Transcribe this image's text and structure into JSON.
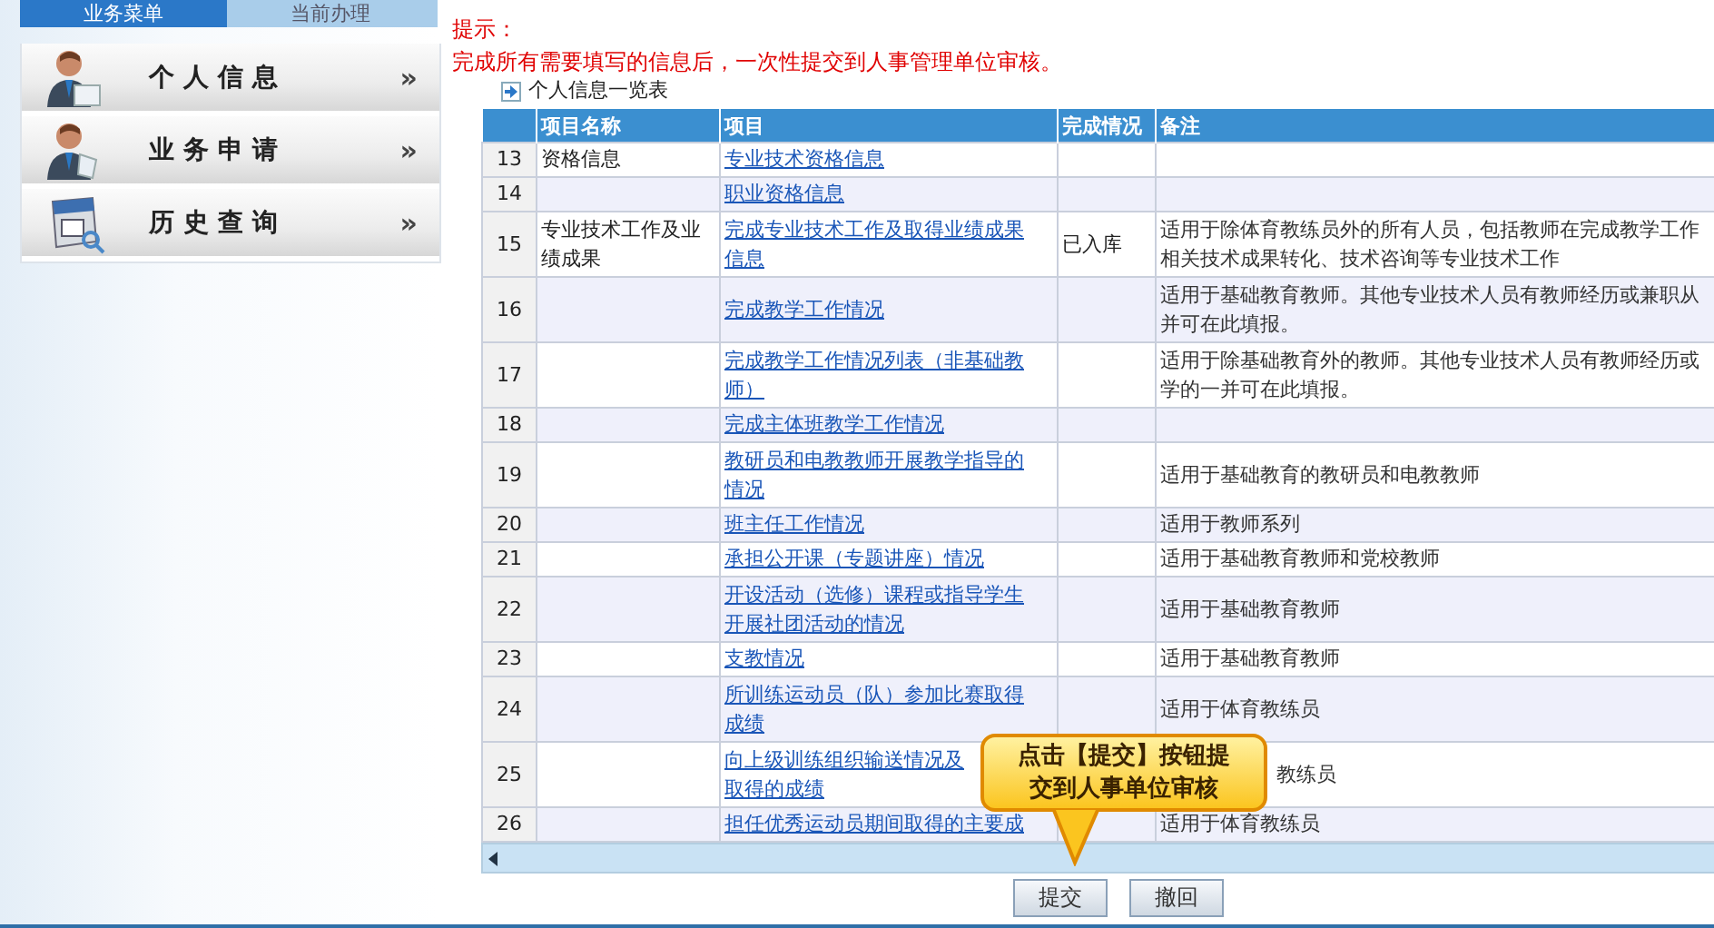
{
  "sidebar": {
    "tabs": [
      {
        "label": "业务菜单",
        "selected": true
      },
      {
        "label": "当前办理",
        "selected": false
      }
    ],
    "items": [
      {
        "kind": "person-card",
        "label": "个人信息",
        "chevron": "»"
      },
      {
        "kind": "person-doc",
        "label": "业务申请",
        "chevron": "»"
      },
      {
        "kind": "calendar",
        "label": "历史查询",
        "chevron": "»"
      }
    ]
  },
  "hint": {
    "title": "提示：",
    "text": "完成所有需要填写的信息后，一次性提交到人事管理单位审核。"
  },
  "table": {
    "caption": "个人信息一览表",
    "columns": [
      "项目名称",
      "项目",
      "完成情况",
      "备注"
    ],
    "rows": [
      {
        "no": "13",
        "name": [
          "资格信息"
        ],
        "item": [
          "专业技术资格信息"
        ],
        "status": "",
        "remark": []
      },
      {
        "no": "14",
        "name": [],
        "item": [
          "职业资格信息"
        ],
        "status": "",
        "remark": []
      },
      {
        "no": "15",
        "name": [
          "专业技术工作及业",
          "绩成果"
        ],
        "item": [
          "完成专业技术工作及取得业绩成果",
          "信息"
        ],
        "status": "已入库",
        "remark": [
          "适用于除体育教练员外的所有人员，包括教师在完成教学工作",
          "相关技术成果转化、技术咨询等专业技术工作"
        ]
      },
      {
        "no": "16",
        "name": [],
        "item": [
          "完成教学工作情况"
        ],
        "status": "",
        "remark": [
          "适用于基础教育教师。其他专业技术人员有教师经历或兼职从",
          "并可在此填报。"
        ]
      },
      {
        "no": "17",
        "name": [],
        "item": [
          "完成教学工作情况列表（非基础教",
          "师）"
        ],
        "status": "",
        "remark": [
          "适用于除基础教育外的教师。其他专业技术人员有教师经历或",
          "学的一并可在此填报。"
        ]
      },
      {
        "no": "18",
        "name": [],
        "item": [
          "完成主体班教学工作情况"
        ],
        "status": "",
        "remark": []
      },
      {
        "no": "19",
        "name": [],
        "item": [
          "教研员和电教教师开展教学指导的",
          "情况"
        ],
        "status": "",
        "remark": [
          "适用于基础教育的教研员和电教教师"
        ]
      },
      {
        "no": "20",
        "name": [],
        "item": [
          "班主任工作情况"
        ],
        "status": "",
        "remark": [
          "适用于教师系列"
        ]
      },
      {
        "no": "21",
        "name": [],
        "item": [
          "承担公开课（专题讲座）情况"
        ],
        "status": "",
        "remark": [
          "适用于基础教育教师和党校教师"
        ]
      },
      {
        "no": "22",
        "name": [],
        "item": [
          "开设活动（选修）课程或指导学生",
          "开展社团活动的情况"
        ],
        "status": "",
        "remark": [
          "适用于基础教育教师"
        ]
      },
      {
        "no": "23",
        "name": [],
        "item": [
          "支教情况"
        ],
        "status": "",
        "remark": [
          "适用于基础教育教师"
        ]
      },
      {
        "no": "24",
        "name": [],
        "item": [
          "所训练运动员（队）参加比赛取得",
          "成绩"
        ],
        "status": "",
        "remark": [
          "适用于体育教练员"
        ]
      },
      {
        "no": "25",
        "name": [],
        "item": [
          "向上级训练组织输送情况及",
          "取得的成绩"
        ],
        "status": "",
        "remark": [
          "教练员"
        ]
      },
      {
        "no": "26",
        "name": [],
        "item": [
          "担任优秀运动员期间取得的主要成"
        ],
        "status": "",
        "remark": [
          "适用于体育教练员"
        ]
      }
    ]
  },
  "callout": {
    "lines": [
      "点击【提交】按钮提",
      "交到人事单位审核"
    ]
  },
  "buttons": [
    {
      "label": "提交"
    },
    {
      "label": "撤回"
    }
  ]
}
